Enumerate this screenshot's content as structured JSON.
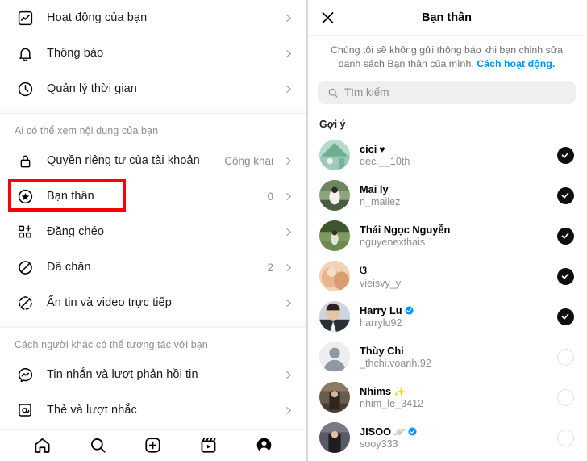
{
  "left_panel": {
    "groups": [
      {
        "header": null,
        "items": [
          {
            "icon": "activity-chart-icon",
            "label": "Hoạt động của bạn",
            "value": ""
          },
          {
            "icon": "bell-icon",
            "label": "Thông báo",
            "value": ""
          },
          {
            "icon": "clock-icon",
            "label": "Quản lý thời gian",
            "value": ""
          }
        ]
      },
      {
        "header": "Ai có thể xem nội dung của bạn",
        "items": [
          {
            "icon": "lock-icon",
            "label": "Quyền riêng tư của tài khoản",
            "value": "Công khai"
          },
          {
            "icon": "star-circle-icon",
            "label": "Bạn thân",
            "value": "0",
            "highlighted": true
          },
          {
            "icon": "crosspost-grid-icon",
            "label": "Đăng chéo",
            "value": ""
          },
          {
            "icon": "block-icon",
            "label": "Đã chặn",
            "value": "2"
          },
          {
            "icon": "hide-story-icon",
            "label": "Ẩn tin và video trực tiếp",
            "value": ""
          }
        ]
      },
      {
        "header": "Cách người khác có thể tương tác với bạn",
        "items": [
          {
            "icon": "messenger-icon",
            "label": "Tin nhắn và lượt phản hồi tin",
            "value": ""
          },
          {
            "icon": "at-mention-icon",
            "label": "Thẻ và lượt nhắc",
            "value": ""
          }
        ]
      }
    ],
    "bottom_nav": [
      {
        "icon": "home-icon",
        "label": "Trang chủ"
      },
      {
        "icon": "search-icon",
        "label": "Tìm kiếm"
      },
      {
        "icon": "add-post-icon",
        "label": "Tạo"
      },
      {
        "icon": "reels-icon",
        "label": "Reels"
      },
      {
        "icon": "profile-avatar-icon",
        "label": "Trang cá nhân"
      }
    ],
    "highlight_color": "#ff0000"
  },
  "right_panel": {
    "close_icon": "close-icon",
    "title": "Bạn thân",
    "description_before": "Chúng tôi sẽ không gửi thông báo khi bạn chỉnh sửa danh sách Bạn thân của mình. ",
    "description_link": "Cách hoạt động.",
    "search": {
      "icon": "search-icon",
      "placeholder": "Tìm kiếm",
      "value": ""
    },
    "suggestions_header": "Gợi ý",
    "people": [
      {
        "name": "cici",
        "emoji": "♥",
        "verified": false,
        "username": "dec.__10th",
        "selected": true,
        "avatar_colors": [
          "#8fc6b0",
          "#cfe4dd",
          "#6fae93"
        ]
      },
      {
        "name": "Mai ly",
        "emoji": "",
        "verified": false,
        "username": "n_mailez",
        "selected": true,
        "avatar_colors": [
          "#4a5d44",
          "#8ea47e",
          "#2f3b2c"
        ]
      },
      {
        "name": "Thái Ngọc Nguyễn",
        "emoji": "",
        "verified": false,
        "username": "nguyenexthais",
        "selected": true,
        "avatar_colors": [
          "#3f5530",
          "#7f9a5e",
          "#243318"
        ]
      },
      {
        "name": "ଓ",
        "emoji": "",
        "verified": false,
        "username": "vieisvy_y",
        "selected": true,
        "avatar_colors": [
          "#e8b58c",
          "#f3d3b5",
          "#c88f63"
        ]
      },
      {
        "name": "Harry Lu",
        "emoji": "",
        "verified": true,
        "username": "harrylu92",
        "selected": true,
        "avatar_colors": [
          "#cdd6de",
          "#3a3f46",
          "#8e9aa6"
        ]
      },
      {
        "name": "Thùy Chi",
        "emoji": "",
        "verified": false,
        "username": "_thchi.voanh.92",
        "selected": false,
        "avatar_colors": [
          "#eeeeee",
          "#8e99a4",
          "#8e99a4"
        ]
      },
      {
        "name": "Nhims",
        "emoji": "✨",
        "verified": false,
        "username": "nhim_le_3412",
        "selected": false,
        "avatar_colors": [
          "#5e5346",
          "#2c2520",
          "#8a7a66"
        ]
      },
      {
        "name": "JISOO",
        "emoji": "🪐",
        "verified": true,
        "username": "sooy333",
        "selected": false,
        "avatar_colors": [
          "#4a4a52",
          "#1d1d22",
          "#7a7a84"
        ]
      }
    ],
    "colors": {
      "link": "#0095f6",
      "verified": "#0095f6",
      "selected_fill": "#0f0f0f"
    }
  }
}
